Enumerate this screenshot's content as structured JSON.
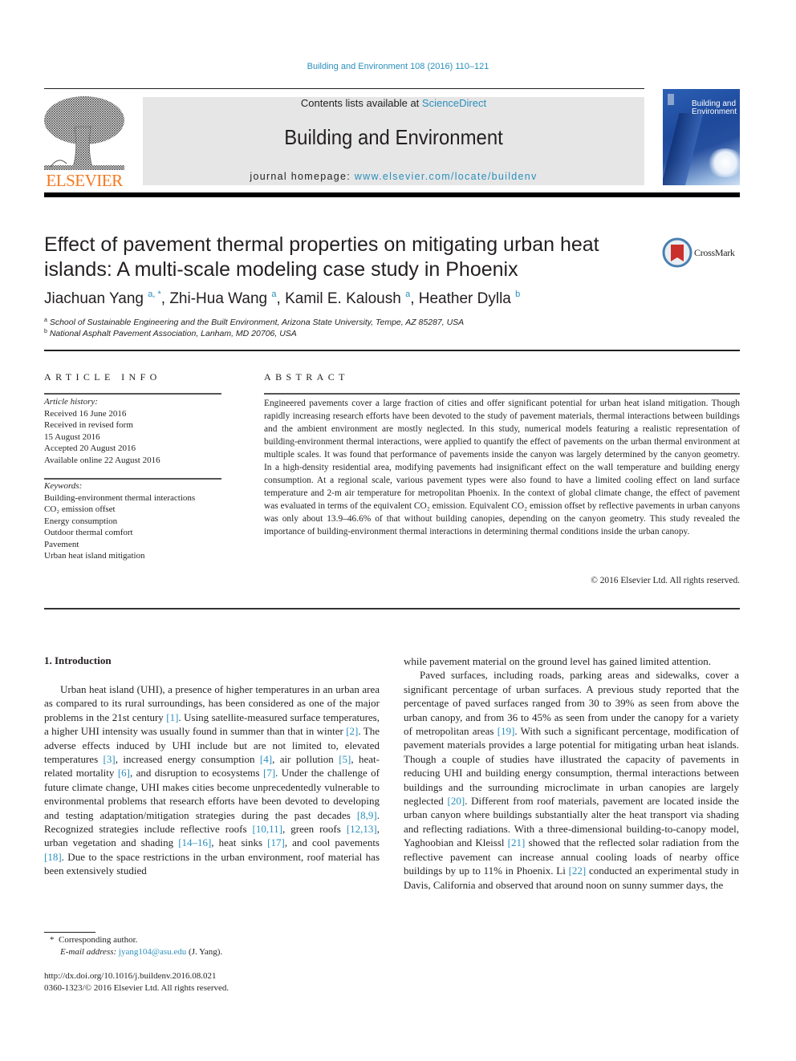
{
  "running_head": "Building and Environment 108 (2016) 110–121",
  "masthead": {
    "publisher_wordmark": "ELSEVIER",
    "contents_prefix": "Contents lists available at ",
    "contents_link": "ScienceDirect",
    "journal_title": "Building and Environment",
    "homepage_prefix": "journal homepage: ",
    "homepage_link": "www.elsevier.com/locate/buildenv",
    "cover_title_line1": "Building and",
    "cover_title_line2": "Environment",
    "colors": {
      "elsevier_orange": "#f47920",
      "link_blue": "#2a8fbd",
      "masthead_gray": "#e6e6e6"
    }
  },
  "article": {
    "title": "Effect of pavement thermal properties on mitigating urban heat islands: A multi-scale modeling case study in Phoenix",
    "crossmark_label": "CrossMark",
    "authors": [
      {
        "name": "Jiachuan Yang",
        "sup": "a, *"
      },
      {
        "name": "Zhi-Hua Wang",
        "sup": "a"
      },
      {
        "name": "Kamil E. Kaloush",
        "sup": "a"
      },
      {
        "name": "Heather Dylla",
        "sup": "b"
      }
    ],
    "affiliations": [
      {
        "key": "a",
        "text": "School of Sustainable Engineering and the Built Environment, Arizona State University, Tempe, AZ 85287, USA"
      },
      {
        "key": "b",
        "text": "National Asphalt Pavement Association, Lanham, MD 20706, USA"
      }
    ]
  },
  "article_info": {
    "heading": "ARTICLE INFO",
    "history_label": "Article history:",
    "history": [
      "Received 16 June 2016",
      "Received in revised form",
      "15 August 2016",
      "Accepted 20 August 2016",
      "Available online 22 August 2016"
    ],
    "keywords_label": "Keywords:",
    "keywords": [
      "Building-environment thermal interactions",
      "CO₂ emission offset",
      "Energy consumption",
      "Outdoor thermal comfort",
      "Pavement",
      "Urban heat island mitigation"
    ]
  },
  "abstract": {
    "heading": "ABSTRACT",
    "text": "Engineered pavements cover a large fraction of cities and offer significant potential for urban heat island mitigation. Though rapidly increasing research efforts have been devoted to the study of pavement materials, thermal interactions between buildings and the ambient environment are mostly neglected. In this study, numerical models featuring a realistic representation of building-environment thermal interactions, were applied to quantify the effect of pavements on the urban thermal environment at multiple scales. It was found that performance of pavements inside the canyon was largely determined by the canyon geometry. In a high-density residential area, modifying pavements had insignificant effect on the wall temperature and building energy consumption. At a regional scale, various pavement types were also found to have a limited cooling effect on land surface temperature and 2-m air temperature for metropolitan Phoenix. In the context of global climate change, the effect of pavement was evaluated in terms of the equivalent CO₂ emission. Equivalent CO₂ emission offset by reflective pavements in urban canyons was only about 13.9–46.6% of that without building canopies, depending on the canyon geometry. This study revealed the importance of building-environment thermal interactions in determining thermal conditions inside the urban canopy.",
    "copyright": "© 2016 Elsevier Ltd. All rights reserved."
  },
  "body": {
    "section_heading": "1.  Introduction",
    "left_paragraph": [
      {
        "t": "Urban heat island (UHI), a presence of higher temperatures in an urban area as compared to its rural surroundings, has been considered as one of the major problems in the 21st century "
      },
      {
        "ref": "[1]"
      },
      {
        "t": ". Using satellite-measured surface temperatures, a higher UHI intensity was usually found in summer than that in winter "
      },
      {
        "ref": "[2]"
      },
      {
        "t": ". The adverse effects induced by UHI include but are not limited to, elevated temperatures "
      },
      {
        "ref": "[3]"
      },
      {
        "t": ", increased energy consumption "
      },
      {
        "ref": "[4]"
      },
      {
        "t": ", air pollution "
      },
      {
        "ref": "[5]"
      },
      {
        "t": ", heat-related mortality "
      },
      {
        "ref": "[6]"
      },
      {
        "t": ", and disruption to ecosystems "
      },
      {
        "ref": "[7]"
      },
      {
        "t": ". Under the challenge of future climate change, UHI makes cities become unprecedentedly vulnerable to environmental problems that research efforts have been devoted to developing and testing adaptation/mitigation strategies during the past decades "
      },
      {
        "ref": "[8,9]"
      },
      {
        "t": ". Recognized strategies include reflective roofs "
      },
      {
        "ref": "[10,11]"
      },
      {
        "t": ", green roofs "
      },
      {
        "ref": "[12,13]"
      },
      {
        "t": ", urban vegetation and shading "
      },
      {
        "ref": "[14–16]"
      },
      {
        "t": ", heat sinks "
      },
      {
        "ref": "[17]"
      },
      {
        "t": ", and cool pavements "
      },
      {
        "ref": "[18]"
      },
      {
        "t": ". Due to the space restrictions in the urban environment, roof material has been extensively studied"
      }
    ],
    "right_paragraph_1": "while pavement material on the ground level has gained limited attention.",
    "right_paragraph_2": [
      {
        "t": "Paved surfaces, including roads, parking areas and sidewalks, cover a significant percentage of urban surfaces. A previous study reported that the percentage of paved surfaces ranged from 30 to 39% as seen from above the urban canopy, and from 36 to 45% as seen from under the canopy for a variety of metropolitan areas "
      },
      {
        "ref": "[19]"
      },
      {
        "t": ". With such a significant percentage, modification of pavement materials provides a large potential for mitigating urban heat islands. Though a couple of studies have illustrated the capacity of pavements in reducing UHI and building energy consumption, thermal interactions between buildings and the surrounding microclimate in urban canopies are largely neglected "
      },
      {
        "ref": "[20]"
      },
      {
        "t": ". Different from roof materials, pavement are located inside the urban canyon where buildings substantially alter the heat transport via shading and reflecting radiations. With a three-dimensional building-to-canopy model, Yaghoobian and Kleissl "
      },
      {
        "ref": "[21]"
      },
      {
        "t": " showed that the reflected solar radiation from the reflective pavement can increase annual cooling loads of nearby office buildings by up to 11% in Phoenix. Li "
      },
      {
        "ref": "[22]"
      },
      {
        "t": " conducted an experimental study in Davis, California and observed that around noon on sunny summer days, the"
      }
    ]
  },
  "footnotes": {
    "corresponding_mark": "*",
    "corresponding_text": "Corresponding author.",
    "email_label": "E-mail address: ",
    "email": "jyang104@asu.edu",
    "email_suffix": " (J. Yang).",
    "doi": "http://dx.doi.org/10.1016/j.buildenv.2016.08.021",
    "issn_line": "0360-1323/© 2016 Elsevier Ltd. All rights reserved."
  }
}
